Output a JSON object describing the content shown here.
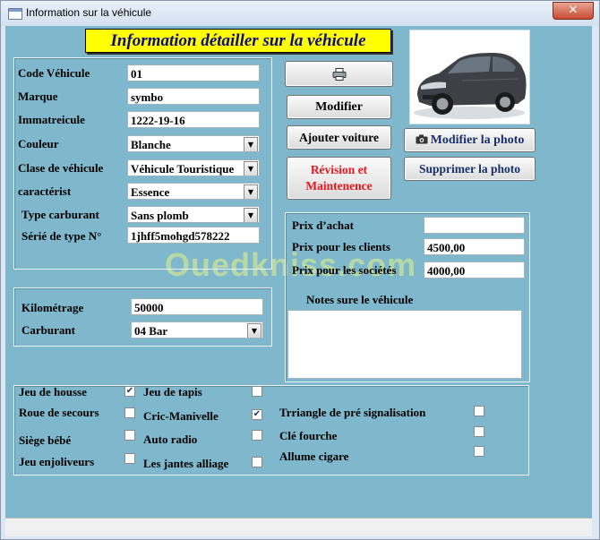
{
  "window": {
    "title": "Information sur la véhicule",
    "close_glyph": "✕"
  },
  "header": {
    "title": "Information détailler sur la véhicule"
  },
  "vehicle_form": {
    "code_label": "Code Véhicule",
    "code_value": "01",
    "marque_label": "Marque",
    "marque_value": "symbo",
    "immat_label": "Immatreicule",
    "immat_value": "1222-19-16",
    "couleur_label": "Couleur",
    "couleur_value": "Blanche",
    "classe_label": "Clase de véhicule",
    "classe_value": "Véhicule Touristique",
    "caract_label": "caractérist",
    "caract_value": "Essence",
    "type_carb_label": "Type carburant",
    "type_carb_value": "Sans plomb",
    "serie_label": "Sérié de type N°",
    "serie_value": "1jhff5mohgd578222"
  },
  "km_group": {
    "km_label": "Kilométrage",
    "km_value": "50000",
    "carb_label": "Carburant",
    "carb_value": "04 Bar"
  },
  "buttons": {
    "print_icon": "printer-icon",
    "modifier": "Modifier",
    "ajouter": "Ajouter voiture",
    "revision": "Révision et Maintenence",
    "revision_color": "#e8151b",
    "modifier_photo": "Modifier la  photo",
    "supprimer_photo": "Supprimer la photo",
    "supprimer_color": "#1a2f6b"
  },
  "prices": {
    "achat_label": "Prix d’achat",
    "achat_value": "",
    "clients_label": "Prix pour les clients",
    "clients_value": "4500,00",
    "societes_label": "Prix pour les sociétés",
    "societes_value": "4000,00",
    "notes_label": "Notes sure le véhicule",
    "notes_value": ""
  },
  "equipment": [
    {
      "label": "Jeu de housse",
      "checked": true
    },
    {
      "label": "Roue de secours",
      "checked": false
    },
    {
      "label": "Siège bébé",
      "checked": false
    },
    {
      "label": "Jeu enjoliveurs",
      "checked": false
    },
    {
      "label": "Jeu de tapis",
      "checked": false
    },
    {
      "label": "Cric-Manivelle",
      "checked": true
    },
    {
      "label": "Auto radio",
      "checked": false
    },
    {
      "label": "Les jantes alliage",
      "checked": false
    },
    {
      "label": "Trriangle de pré signalisation",
      "checked": false
    },
    {
      "label": "Clé fourche",
      "checked": false
    },
    {
      "label": "Allume cigare",
      "checked": false
    }
  ],
  "watermark": {
    "text": "Ouedkniss.com"
  },
  "colors": {
    "background": "#7fb8cc",
    "header_bg": "#ffff00",
    "header_text": "#0c0c8a"
  }
}
